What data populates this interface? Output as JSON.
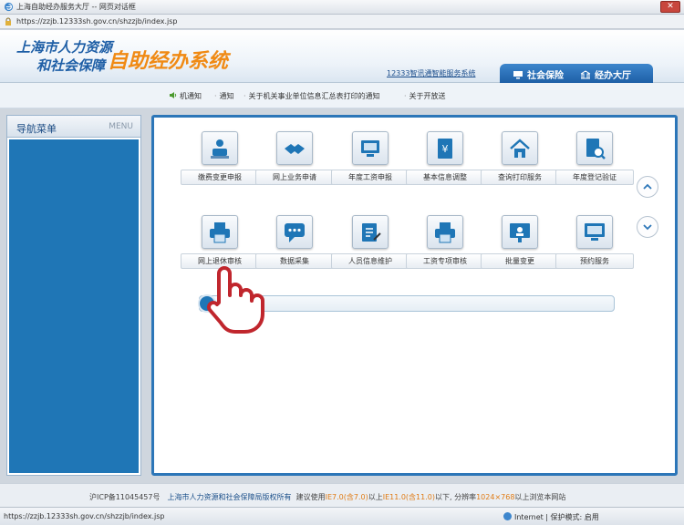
{
  "window": {
    "title": "上海自助经办服务大厅 -- 网页对话框",
    "address": "https://zzjb.12333sh.gov.cn/shzzjb/index.jsp"
  },
  "header": {
    "logo_line1": "上海市人力资源",
    "logo_line2": "和社会保障",
    "system_name": "自助经办系统",
    "helpline": "12333智讯通智能服务系统",
    "tabs": [
      {
        "label": "社会保险",
        "icon": "monitor-icon"
      },
      {
        "label": "经办大厅",
        "icon": "building-icon"
      }
    ]
  },
  "notices": [
    "机通知",
    "通知",
    "关于机关事业单位信息汇总表打印的通知",
    "关于开放送"
  ],
  "sidebar": {
    "title": "导航菜单",
    "menu_label": "MENU"
  },
  "tiles": [
    {
      "label": "缴费变更申报",
      "icon": "person-desk-icon"
    },
    {
      "label": "网上业务申请",
      "icon": "handshake-icon"
    },
    {
      "label": "年度工资申报",
      "icon": "monitor-icon"
    },
    {
      "label": "基本信息调整",
      "icon": "document-yen-icon"
    },
    {
      "label": "查询打印服务",
      "icon": "home-icon"
    },
    {
      "label": "年度登记验证",
      "icon": "search-document-icon"
    },
    {
      "label": "网上退休审核",
      "icon": "printer-icon"
    },
    {
      "label": "数据采集",
      "icon": "chat-icon"
    },
    {
      "label": "人员信息维护",
      "icon": "edit-document-icon"
    },
    {
      "label": "工资专项审核",
      "icon": "printer-icon"
    },
    {
      "label": "批量变更",
      "icon": "presentation-icon"
    },
    {
      "label": "预约服务",
      "icon": "monitor-icon"
    }
  ],
  "footer": {
    "icp": "沪ICP备11045457号",
    "org": "上海市人力资源和社会保障局版权所有",
    "note_a": "建议使用",
    "ie7": "IE7.0(含7.0)",
    "note_b": "以上",
    "ie11": "IE11.0(含11.0)",
    "note_c": "以下, 分辨率",
    "res": "1024×768",
    "note_d": "以上浏览本网站"
  },
  "statusbar": {
    "url": "https://zzjb.12333sh.gov.cn/shzzjb/index.jsp",
    "zone": "Internet | 保护模式: 启用"
  }
}
